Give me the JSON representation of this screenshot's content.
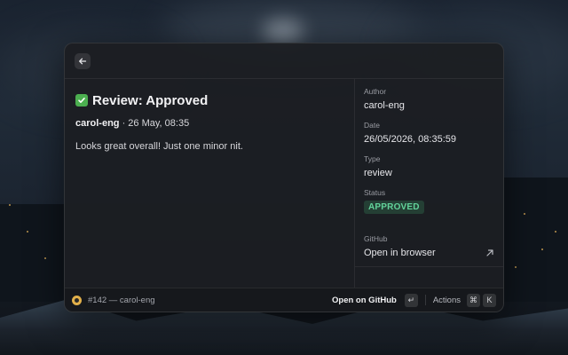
{
  "review": {
    "title": "Review: Approved",
    "author": "carol-eng",
    "date_short": "26 May, 08:35",
    "separator": " · ",
    "body": "Looks great overall! Just one minor nit."
  },
  "details": {
    "author_label": "Author",
    "author_value": "carol-eng",
    "date_label": "Date",
    "date_value": "26/05/2026, 08:35:59",
    "type_label": "Type",
    "type_value": "review",
    "status_label": "Status",
    "status_value": "APPROVED",
    "github_label": "GitHub",
    "github_link": "Open in browser"
  },
  "footer": {
    "context": "#142 — carol-eng",
    "primary_action": "Open on GitHub",
    "enter_key": "↵",
    "actions_label": "Actions",
    "cmd_key": "⌘",
    "k_key": "K"
  },
  "colors": {
    "status_approved": "#62d39a",
    "check": "#4caf50"
  }
}
